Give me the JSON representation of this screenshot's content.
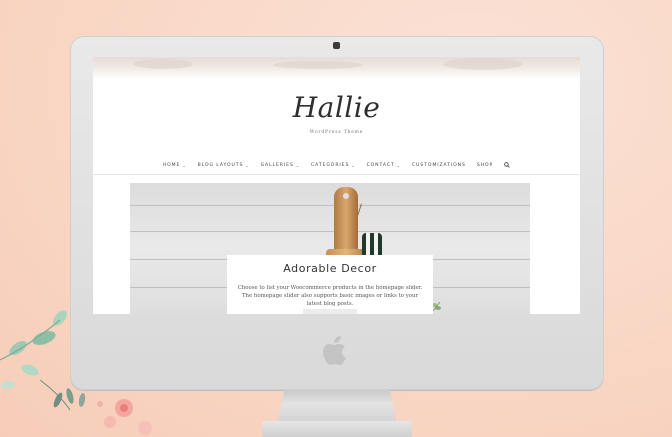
{
  "site": {
    "logo_text": "Hallie",
    "tagline": "WordPress Theme"
  },
  "nav": {
    "items": [
      {
        "label": "HOME",
        "has_dropdown": true
      },
      {
        "label": "BLOG LAYOUTS",
        "has_dropdown": true
      },
      {
        "label": "GALLERIES",
        "has_dropdown": true
      },
      {
        "label": "CATEGORIES",
        "has_dropdown": true
      },
      {
        "label": "CONTACT",
        "has_dropdown": true
      },
      {
        "label": "CUSTOMIZATIONS",
        "has_dropdown": false
      },
      {
        "label": "SHOP",
        "has_dropdown": false
      }
    ],
    "search_icon": "search-icon"
  },
  "hero": {
    "title": "Adorable Decor",
    "text": "Choose to list your Woocommerce products in the homepage slider. The homepage slider also supports basic images or links to your latest blog posts."
  },
  "colors": {
    "background": "#f9d8c8",
    "monitor": "#e3e3e3",
    "accent_green": "#1f3a2c",
    "wood": "#d9a66c"
  }
}
